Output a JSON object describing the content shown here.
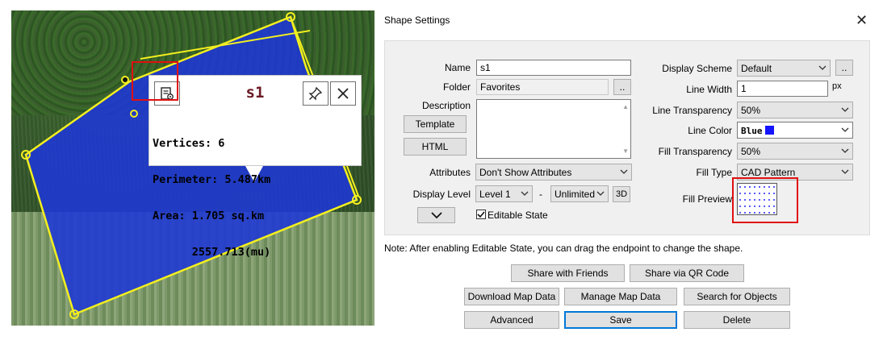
{
  "map": {
    "popup": {
      "title": "s1",
      "stats_lines": [
        "Vertices: 6",
        "Perimeter: 5.487km",
        "Area: 1.705 sq.km",
        "      2557.713(mu)"
      ],
      "left_icon": "document-settings-icon",
      "pin_icon": "pin-icon",
      "close_icon": "close-icon"
    },
    "colors": {
      "polygon_fill": "#1e37d6",
      "polygon_stroke": "#f3ef1f",
      "highlight": "#e01010"
    }
  },
  "dialog": {
    "title": "Shape Settings",
    "close_glyph": "✕",
    "name_label": "Name",
    "name_value": "s1",
    "folder_label": "Folder",
    "folder_value": "Favorites",
    "browse_glyph": "..",
    "description_label": "Description",
    "template_button": "Template",
    "html_button": "HTML",
    "attributes_label": "Attributes",
    "attributes_value": "Don't Show Attributes",
    "display_level_label": "Display Level",
    "display_level_value": "Level 1",
    "level_separator": "-",
    "display_level_max": "Unlimited",
    "three_d_button": "3D",
    "editable_state_label": "Editable State",
    "editable_state_checked": true,
    "display_scheme_label": "Display Scheme",
    "display_scheme_value": "Default",
    "line_width_label": "Line Width",
    "line_width_value": "1",
    "line_width_unit": "px",
    "line_transparency_label": "Line Transparency",
    "line_transparency_value": "50%",
    "line_color_label": "Line Color",
    "line_color_value": "Blue",
    "line_color_swatch": "#1414ff",
    "fill_transparency_label": "Fill Transparency",
    "fill_transparency_value": "50%",
    "fill_type_label": "Fill Type",
    "fill_type_value": "CAD Pattern",
    "fill_preview_label": "Fill Preview",
    "note": "Note: After enabling Editable State, you can drag the endpoint to change the shape.",
    "buttons": {
      "share_friends": "Share with Friends",
      "share_qr": "Share via QR Code",
      "download": "Download Map Data",
      "manage": "Manage Map Data",
      "search": "Search for Objects",
      "advanced": "Advanced",
      "save": "Save",
      "delete": "Delete"
    }
  }
}
